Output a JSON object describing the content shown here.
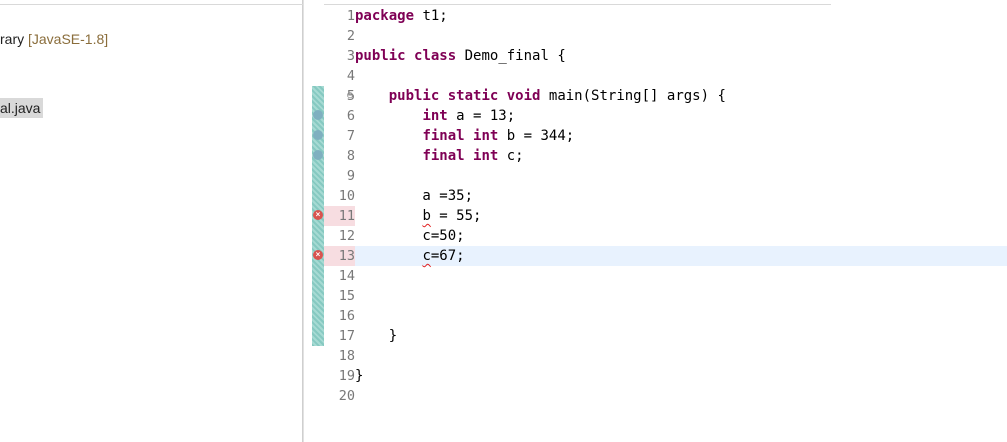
{
  "explorer": {
    "items": [
      {
        "label": "rary ",
        "suffix": "[JavaSE-1.8]"
      },
      {
        "label": "al.java"
      }
    ]
  },
  "editor": {
    "lines": [
      {
        "n": "1",
        "code": [
          {
            "t": "package",
            "k": true
          },
          {
            "t": " t1;"
          }
        ]
      },
      {
        "n": "2",
        "code": []
      },
      {
        "n": "3",
        "code": [
          {
            "t": "public",
            "k": true
          },
          {
            "t": " "
          },
          {
            "t": "class",
            "k": true
          },
          {
            "t": " Demo_final {"
          }
        ]
      },
      {
        "n": "4",
        "code": []
      },
      {
        "n": "5",
        "code": [
          {
            "t": "    "
          },
          {
            "t": "public",
            "k": true
          },
          {
            "t": " "
          },
          {
            "t": "static",
            "k": true
          },
          {
            "t": " "
          },
          {
            "t": "void",
            "k": true
          },
          {
            "t": " main(String[] args) {"
          }
        ]
      },
      {
        "n": "6",
        "code": [
          {
            "t": "        "
          },
          {
            "t": "int",
            "k": true
          },
          {
            "t": " a = 13;"
          }
        ]
      },
      {
        "n": "7",
        "code": [
          {
            "t": "        "
          },
          {
            "t": "final",
            "k": true
          },
          {
            "t": " "
          },
          {
            "t": "int",
            "k": true
          },
          {
            "t": " b = 344;"
          }
        ]
      },
      {
        "n": "8",
        "code": [
          {
            "t": "        "
          },
          {
            "t": "final",
            "k": true
          },
          {
            "t": " "
          },
          {
            "t": "int",
            "k": true
          },
          {
            "t": " c;"
          }
        ]
      },
      {
        "n": "9",
        "code": []
      },
      {
        "n": "10",
        "code": [
          {
            "t": "        a =35;"
          }
        ]
      },
      {
        "n": "11",
        "code": [
          {
            "t": "        "
          },
          {
            "t": "b",
            "err": true
          },
          {
            "t": " = 55;"
          }
        ]
      },
      {
        "n": "12",
        "code": [
          {
            "t": "        c=50;"
          }
        ]
      },
      {
        "n": "13",
        "code": [
          {
            "t": "        "
          },
          {
            "t": "c",
            "err": true
          },
          {
            "t": "=67;"
          }
        ]
      },
      {
        "n": "14",
        "code": []
      },
      {
        "n": "15",
        "code": []
      },
      {
        "n": "16",
        "code": []
      },
      {
        "n": "17",
        "code": [
          {
            "t": "    }"
          }
        ]
      },
      {
        "n": "18",
        "code": []
      },
      {
        "n": "19",
        "code": [
          {
            "t": "}"
          }
        ]
      },
      {
        "n": "20",
        "code": []
      }
    ],
    "error_lines": [
      "11",
      "13"
    ],
    "current_line": "13",
    "fold_marker": "⊖",
    "colors": {
      "keyword": "#7f0055",
      "current_line": "#e8f2fe",
      "error": "#e02020"
    }
  }
}
